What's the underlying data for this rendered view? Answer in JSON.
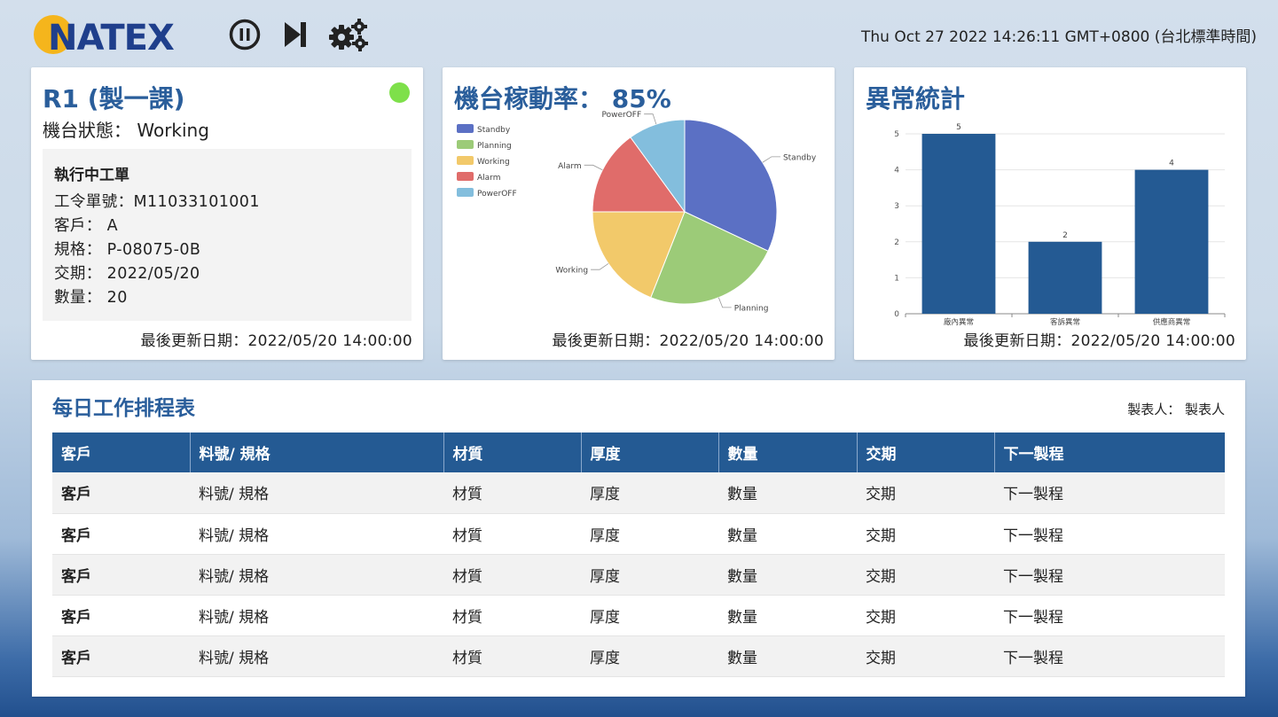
{
  "header": {
    "logo_text": "NATEX",
    "clock": "Thu Oct 27 2022 14:26:11 GMT+0800 (台北標準時間)",
    "icons": [
      "pause-icon",
      "skip-next-icon",
      "settings-gears-icon"
    ]
  },
  "machine": {
    "title": "R1 (製一課)",
    "status_label": "機台狀態：",
    "status_value": "Working",
    "status_color": "#7ee04a",
    "job": {
      "title": "執行中工單",
      "rows": [
        {
          "label": "工令單號：",
          "value": "M11033101001"
        },
        {
          "label": "客戶：",
          "value": "A"
        },
        {
          "label": "規格：",
          "value": "P-08075-0B"
        },
        {
          "label": "交期：",
          "value": "2022/05/20"
        },
        {
          "label": "數量：",
          "value": "20"
        }
      ]
    },
    "updated": "最後更新日期：2022/05/20 14:00:00"
  },
  "utilization": {
    "title": "機台稼動率： 85%",
    "updated": "最後更新日期：2022/05/20 14:00:00",
    "chart_data": {
      "type": "pie",
      "title": "",
      "legend_position": "left",
      "slices": [
        {
          "label": "Standby",
          "value": 32,
          "color": "#5b70c4"
        },
        {
          "label": "Planning",
          "value": 24,
          "color": "#9ccb78"
        },
        {
          "label": "Working",
          "value": 19,
          "color": "#f2c96a"
        },
        {
          "label": "Alarm",
          "value": 15,
          "color": "#e06c6a"
        },
        {
          "label": "PowerOFF",
          "value": 10,
          "color": "#83bedd"
        }
      ]
    }
  },
  "abnormal": {
    "title": "異常統計",
    "updated": "最後更新日期：2022/05/20 14:00:00",
    "chart_data": {
      "type": "bar",
      "title": "",
      "categories": [
        "廠內異常",
        "客訴異常",
        "供應商異常"
      ],
      "values": [
        5,
        2,
        4
      ],
      "ylim": [
        0,
        5
      ],
      "yticks": [
        0,
        1,
        2,
        3,
        4,
        5
      ],
      "grid": true,
      "bar_color": "#245a93"
    }
  },
  "schedule": {
    "title": "每日工作排程表",
    "maker": "製表人： 製表人",
    "columns": [
      "客戶",
      "料號/ 規格",
      "材質",
      "厚度",
      "數量",
      "交期",
      "下一製程"
    ],
    "rows": [
      [
        "客戶",
        "料號/ 規格",
        "材質",
        "厚度",
        "數量",
        "交期",
        "下一製程"
      ],
      [
        "客戶",
        "料號/ 規格",
        "材質",
        "厚度",
        "數量",
        "交期",
        "下一製程"
      ],
      [
        "客戶",
        "料號/ 規格",
        "材質",
        "厚度",
        "數量",
        "交期",
        "下一製程"
      ],
      [
        "客戶",
        "料號/ 規格",
        "材質",
        "厚度",
        "數量",
        "交期",
        "下一製程"
      ],
      [
        "客戶",
        "料號/ 規格",
        "材質",
        "厚度",
        "數量",
        "交期",
        "下一製程"
      ]
    ]
  }
}
